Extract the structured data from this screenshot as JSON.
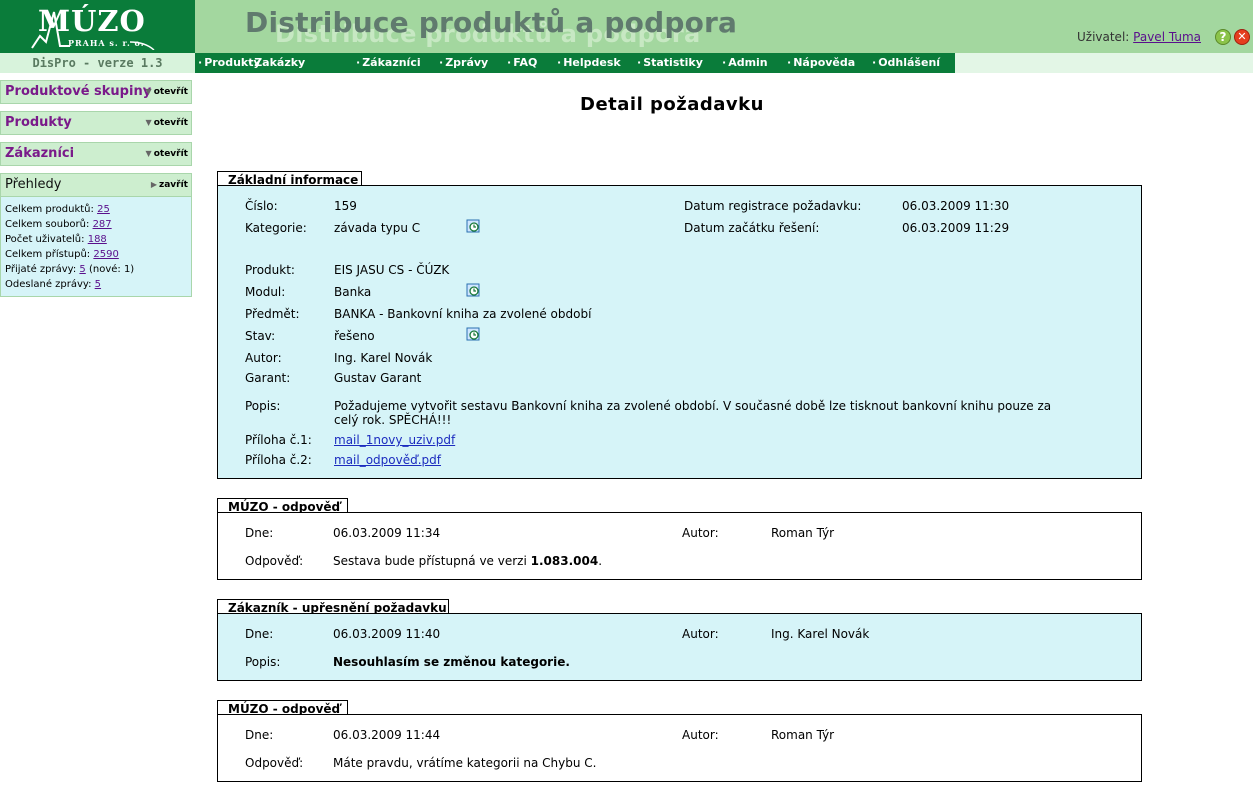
{
  "header": {
    "logo_brand": "MÚZO",
    "logo_sub": "PRAHA s. r. o.",
    "version": "DisPro - verze 1.3",
    "banner_title": "Distribuce produktů a podpora",
    "user_label": "Uživatel:",
    "user_name": "Pavel Tuma"
  },
  "menu": [
    "Produkty",
    "Zakázky",
    "Zákazníci",
    "Zprávy",
    "FAQ",
    "Helpdesk",
    "Statistiky",
    "Admin",
    "Nápověda",
    "Odhlášení"
  ],
  "sidebar": {
    "boxes": [
      {
        "label": "Produktové skupiny",
        "toggle": "otevřít"
      },
      {
        "label": "Produkty",
        "toggle": "otevřít"
      },
      {
        "label": "Zákazníci",
        "toggle": "otevřít"
      },
      {
        "label": "Přehledy",
        "toggle": "zavřít"
      }
    ],
    "stats": [
      {
        "label": "Celkem produktů:",
        "value": "25",
        "extra": ""
      },
      {
        "label": "Celkem souborů:",
        "value": "287",
        "extra": ""
      },
      {
        "label": "Počet uživatelů:",
        "value": "188",
        "extra": ""
      },
      {
        "label": "Celkem přístupů:",
        "value": "2590",
        "extra": ""
      },
      {
        "label": "Přijaté zprávy:",
        "value": "5",
        "extra": "(nové: 1)"
      },
      {
        "label": "Odeslané zprávy:",
        "value": "5",
        "extra": ""
      }
    ]
  },
  "page_title": "Detail požadavku",
  "basic": {
    "tab": "Základní informace",
    "cislo_label": "Číslo:",
    "cislo": "159",
    "kategorie_label": "Kategorie:",
    "kategorie": "závada typu C",
    "datum_reg_label": "Datum registrace požadavku:",
    "datum_reg": "06.03.2009 11:30",
    "datum_zac_label": "Datum začátku řešení:",
    "datum_zac": "06.03.2009 11:29",
    "produkt_label": "Produkt:",
    "produkt": "EIS JASU CS - ČÚZK",
    "modul_label": "Modul:",
    "modul": "Banka",
    "predmet_label": "Předmět:",
    "predmet": "BANKA - Bankovní kniha za zvolené období",
    "stav_label": "Stav:",
    "stav": "řešeno",
    "autor_label": "Autor:",
    "autor": "Ing. Karel Novák",
    "garant_label": "Garant:",
    "garant": "Gustav Garant",
    "popis_label": "Popis:",
    "popis_line1": "Požadujeme vytvořit sestavu Bankovní kniha za zvolené období. V současné době lze tisknout bankovní knihu pouze za",
    "popis_line2": "celý rok. SPĚCHÁ!!!",
    "priloha1_label": "Příloha č.1:",
    "priloha1": "mail_1novy_uziv.pdf",
    "priloha2_label": "Příloha č.2:",
    "priloha2": "mail_odpověď.pdf"
  },
  "replies": [
    {
      "tab": "MÚZO - odpověď",
      "dne_label": "Dne:",
      "dne": "06.03.2009 11:34",
      "autor_label": "Autor:",
      "autor": "Roman Týr",
      "text_label": "Odpověď:",
      "text_pre": "Sestava bude přístupná ve verzi ",
      "text_bold": "1.083.004",
      "text_post": "."
    },
    {
      "tab": "Zákazník - upřesnění požadavku",
      "dne_label": "Dne:",
      "dne": "06.03.2009 11:40",
      "autor_label": "Autor:",
      "autor": "Ing. Karel Novák",
      "text_label": "Popis:",
      "text_pre": "",
      "text_bold": "Nesouhlasím se změnou kategorie.",
      "text_post": ""
    },
    {
      "tab": "MÚZO - odpověď",
      "dne_label": "Dne:",
      "dne": "06.03.2009 11:44",
      "autor_label": "Autor:",
      "autor": "Roman Týr",
      "text_label": "Odpověď:",
      "text_pre": "Máte pravdu, vrátíme kategorii na Chybu C.",
      "text_bold": "",
      "text_post": ""
    }
  ],
  "colors": {
    "dark_green": "#0a7c3a",
    "light_green": "#a3d79f",
    "panel_cyan": "#d6f4f8",
    "link_purple": "#5a0f8c",
    "link_blue": "#1c2cbf"
  },
  "icons": {
    "history": "history-clock-icon",
    "help": "help-icon",
    "close": "close-icon"
  }
}
